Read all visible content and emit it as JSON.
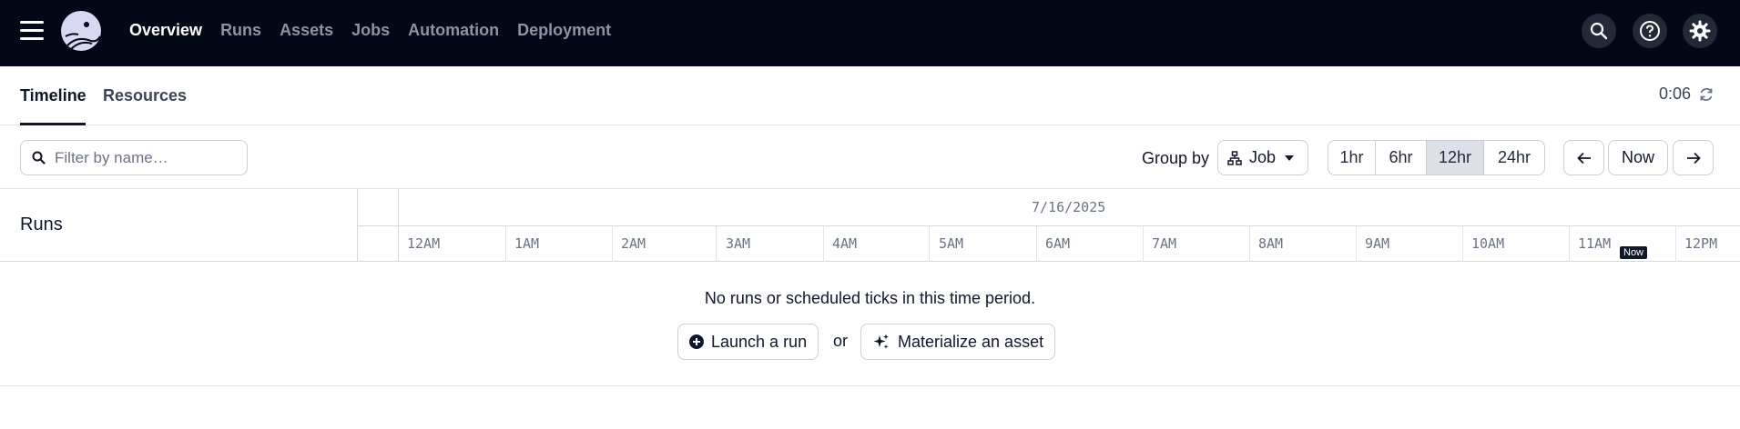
{
  "nav": {
    "links": [
      "Overview",
      "Runs",
      "Assets",
      "Jobs",
      "Automation",
      "Deployment"
    ],
    "active": "Overview",
    "icons": [
      "search-icon",
      "help-icon",
      "settings-icon"
    ]
  },
  "subtabs": {
    "items": [
      "Timeline",
      "Resources"
    ],
    "active": "Timeline",
    "refresh_timer": "0:06"
  },
  "toolbar": {
    "search_placeholder": "Filter by name…",
    "groupby_label": "Group by",
    "groupby_value": "Job",
    "ranges": [
      "1hr",
      "6hr",
      "12hr",
      "24hr"
    ],
    "active_range": "12hr",
    "now_label": "Now"
  },
  "timeline": {
    "runs_label": "Runs",
    "date": "7/16/2025",
    "hours": [
      "12AM",
      "1AM",
      "2AM",
      "3AM",
      "4AM",
      "5AM",
      "6AM",
      "7AM",
      "8AM",
      "9AM",
      "10AM",
      "11AM",
      "12PM"
    ],
    "now_marker": "Now"
  },
  "empty_state": {
    "message": "No runs or scheduled ticks in this time period.",
    "launch_label": "Launch a run",
    "or_text": "or",
    "materialize_label": "Materialize an asset"
  },
  "colors": {
    "nav_bg": "#030816",
    "accent_text": "#0f172a",
    "muted": "#6b7385"
  }
}
